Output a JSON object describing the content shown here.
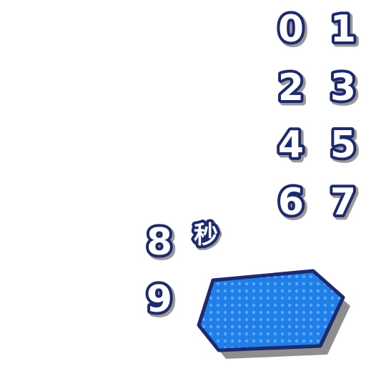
{
  "digit_sheet": {
    "digits": [
      "0",
      "1",
      "2",
      "3",
      "4",
      "5",
      "6",
      "7",
      "8",
      "9"
    ],
    "seconds_label": "秒"
  },
  "colors": {
    "digit_fill": "#ffffff",
    "digit_outline": "#1e2a6e",
    "digit_shadow": "#9a9a9a",
    "panel_fill": "#1f7fe6",
    "panel_dots": "#5aa8ff",
    "panel_border": "#1e2a6e",
    "panel_shadow": "#8e8e8e"
  }
}
